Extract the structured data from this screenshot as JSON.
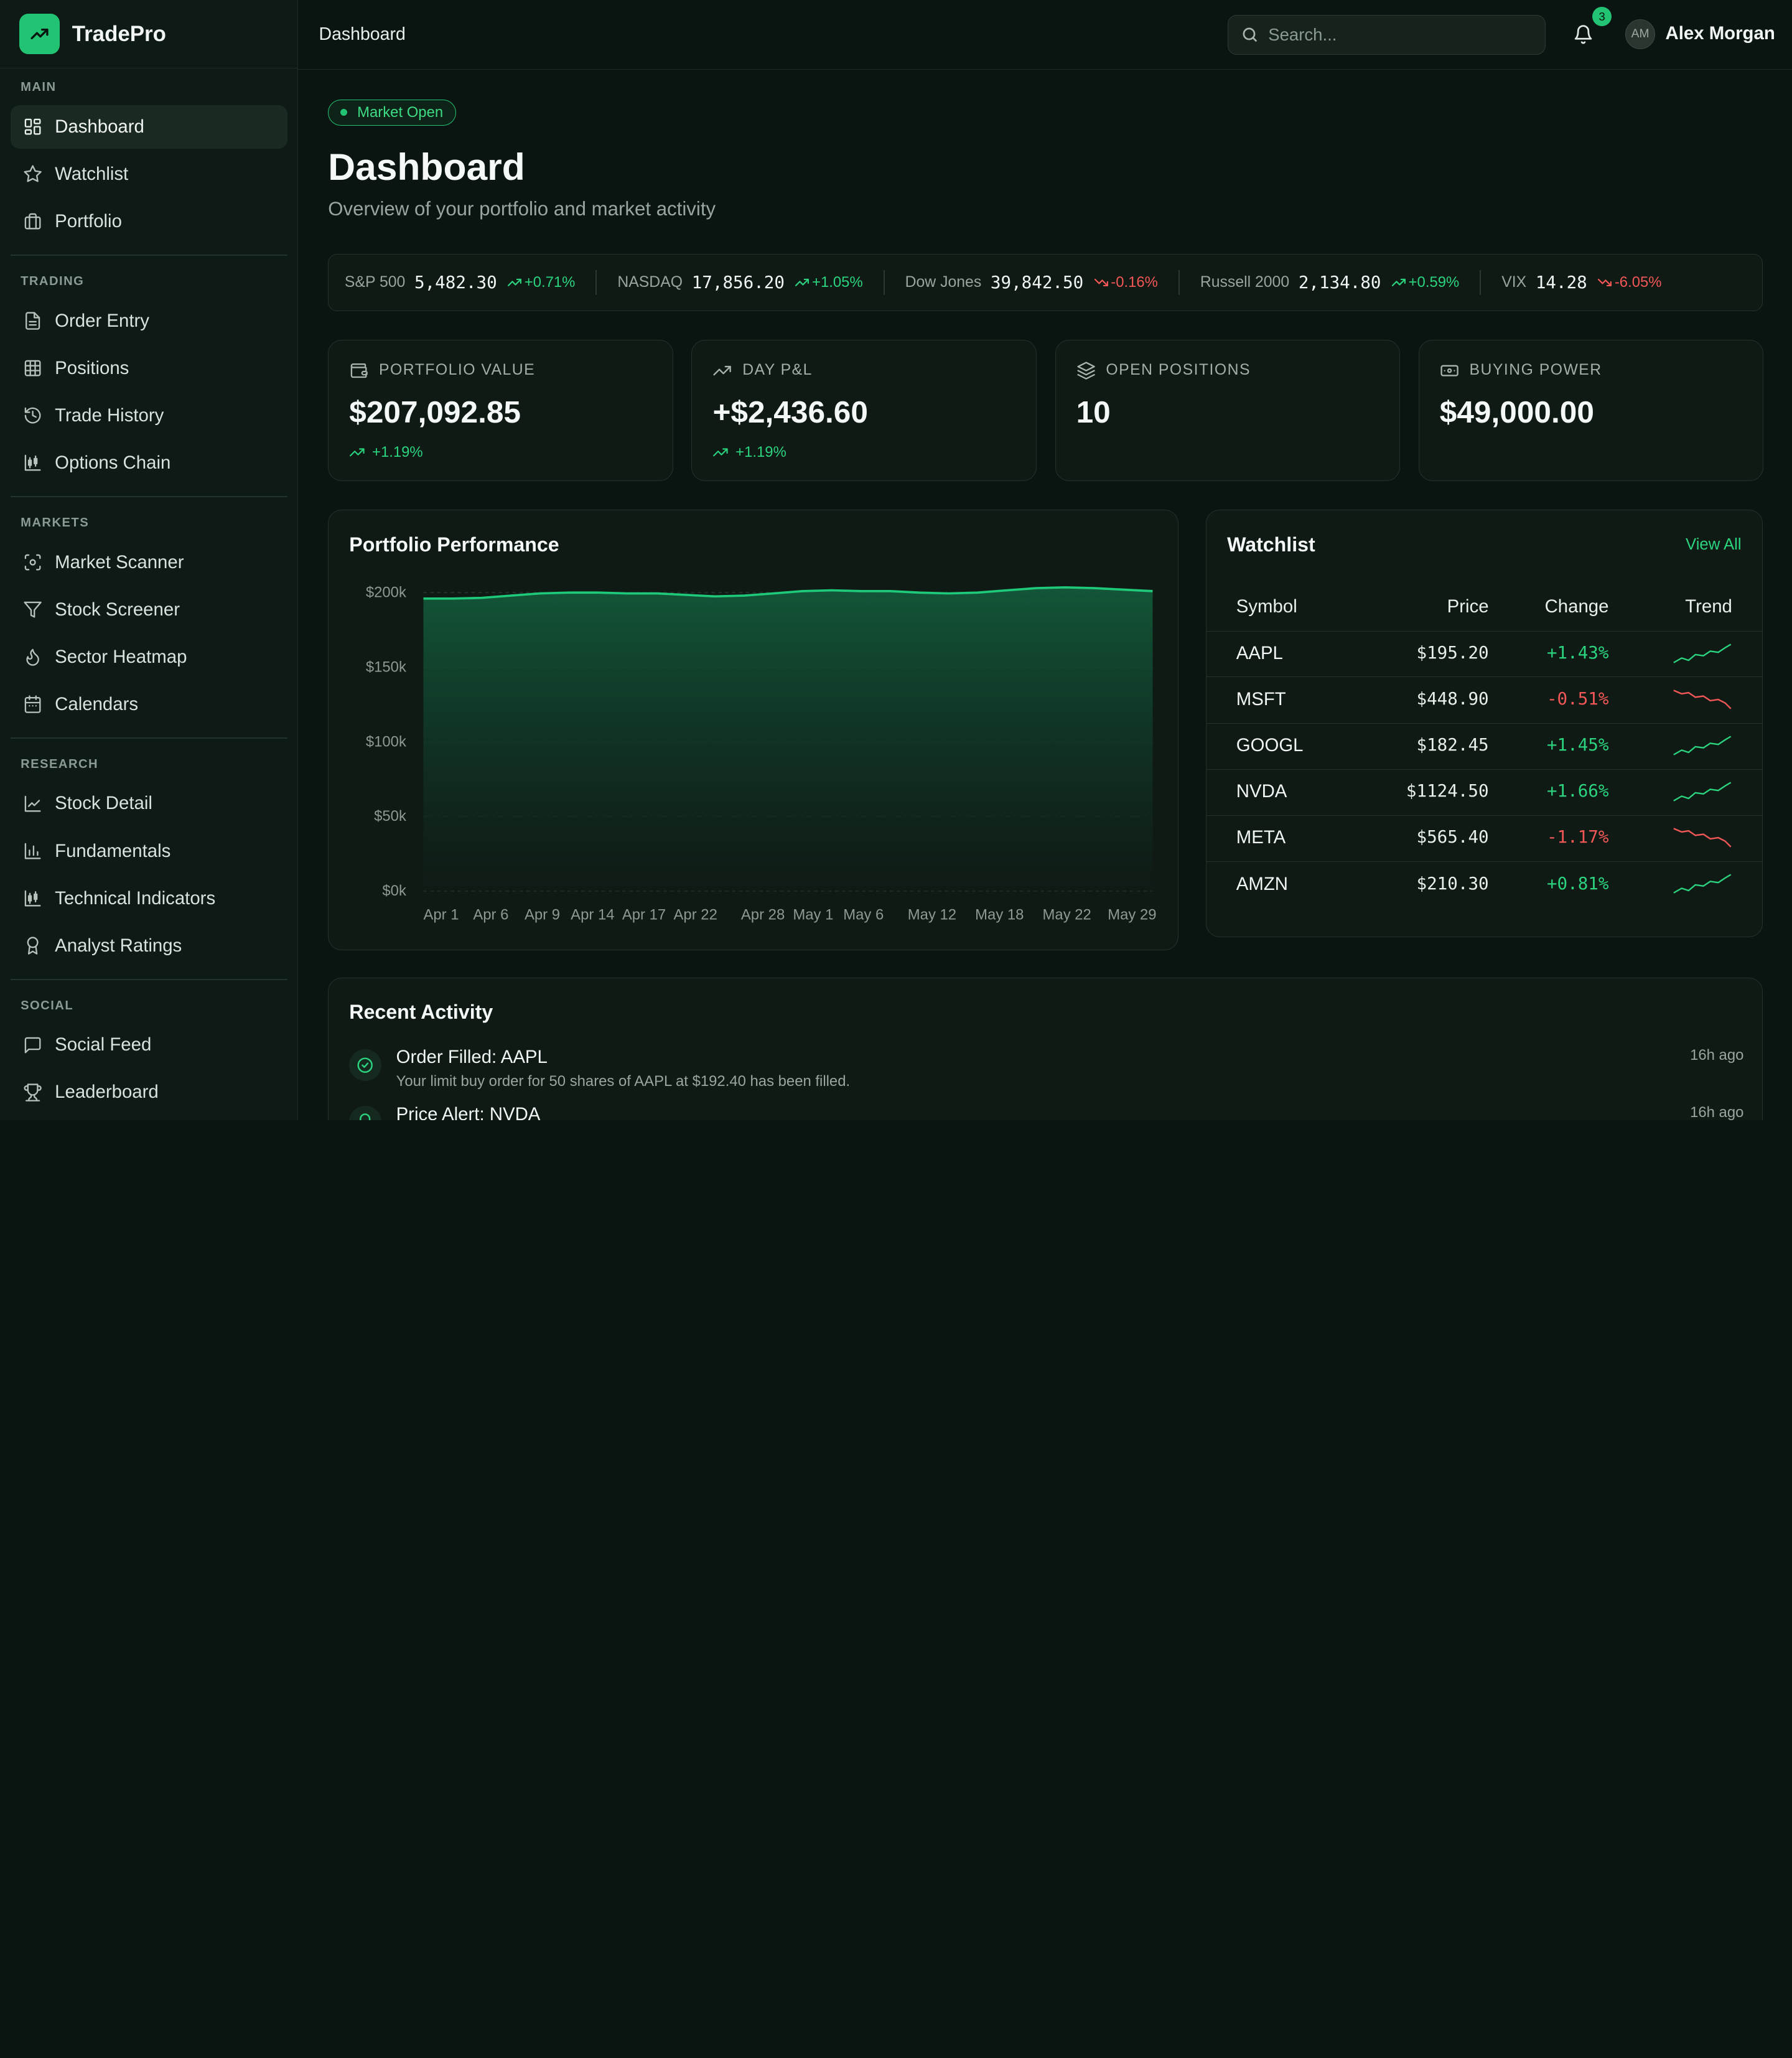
{
  "brand": {
    "name": "TradePro"
  },
  "header": {
    "title": "Dashboard",
    "search_placeholder": "Search...",
    "notification_count": "3",
    "user_initials": "AM",
    "user_name": "Alex Morgan"
  },
  "sidebar": {
    "sections": [
      {
        "title": "MAIN",
        "items": [
          {
            "label": "Dashboard",
            "icon": "dashboard-grid-icon",
            "active": true
          },
          {
            "label": "Watchlist",
            "icon": "star-icon"
          },
          {
            "label": "Portfolio",
            "icon": "briefcase-icon"
          }
        ]
      },
      {
        "title": "TRADING",
        "items": [
          {
            "label": "Order Entry",
            "icon": "document-icon"
          },
          {
            "label": "Positions",
            "icon": "table-grid-icon"
          },
          {
            "label": "Trade History",
            "icon": "history-icon"
          },
          {
            "label": "Options Chain",
            "icon": "candlestick-icon"
          }
        ]
      },
      {
        "title": "MARKETS",
        "items": [
          {
            "label": "Market Scanner",
            "icon": "scan-icon"
          },
          {
            "label": "Stock Screener",
            "icon": "filter-icon"
          },
          {
            "label": "Sector Heatmap",
            "icon": "flame-icon"
          },
          {
            "label": "Calendars",
            "icon": "calendar-icon"
          }
        ]
      },
      {
        "title": "RESEARCH",
        "items": [
          {
            "label": "Stock Detail",
            "icon": "line-chart-icon"
          },
          {
            "label": "Fundamentals",
            "icon": "bar-chart-icon"
          },
          {
            "label": "Technical Indicators",
            "icon": "candlestick-icon"
          },
          {
            "label": "Analyst Ratings",
            "icon": "award-icon"
          }
        ]
      },
      {
        "title": "SOCIAL",
        "items": [
          {
            "label": "Social Feed",
            "icon": "message-icon"
          },
          {
            "label": "Leaderboard",
            "icon": "trophy-icon"
          }
        ]
      }
    ]
  },
  "main": {
    "market_status": "Market Open",
    "title": "Dashboard",
    "subtitle": "Overview of your portfolio and market activity"
  },
  "ticker": [
    {
      "name": "S&P 500",
      "value": "5,482.30",
      "change": "+0.71%",
      "direction": "up"
    },
    {
      "name": "NASDAQ",
      "value": "17,856.20",
      "change": "+1.05%",
      "direction": "up"
    },
    {
      "name": "Dow Jones",
      "value": "39,842.50",
      "change": "-0.16%",
      "direction": "down"
    },
    {
      "name": "Russell 2000",
      "value": "2,134.80",
      "change": "+0.59%",
      "direction": "up"
    },
    {
      "name": "VIX",
      "value": "14.28",
      "change": "-6.05%",
      "direction": "down"
    }
  ],
  "stats": [
    {
      "label": "PORTFOLIO VALUE",
      "value": "$207,092.85",
      "change": "+1.19%",
      "icon": "wallet-icon"
    },
    {
      "label": "DAY P&L",
      "value": "+$2,436.60",
      "change": "+1.19%",
      "icon": "trending-up-icon"
    },
    {
      "label": "OPEN POSITIONS",
      "value": "10",
      "change": "",
      "icon": "layers-icon"
    },
    {
      "label": "BUYING POWER",
      "value": "$49,000.00",
      "change": "",
      "icon": "banknote-icon"
    }
  ],
  "chart_title": "Portfolio Performance",
  "chart_data": {
    "type": "area",
    "title": "Portfolio Performance",
    "x_ticks": [
      "Apr 1",
      "Apr 6",
      "Apr 9",
      "Apr 14",
      "Apr 17",
      "Apr 22",
      "Apr 28",
      "May 1",
      "May 6",
      "May 12",
      "May 18",
      "May 22",
      "May 29"
    ],
    "y_ticks": [
      "$0k",
      "$50k",
      "$100k",
      "$150k",
      "$200k"
    ],
    "ylim": [
      0,
      200000
    ],
    "series": [
      {
        "values": [
          196000,
          196000,
          196500,
          198000,
          199500,
          200000,
          200000,
          199500,
          199500,
          198500,
          197500,
          198000,
          199500,
          201000,
          201500,
          201000,
          201000,
          200000,
          199500,
          200000,
          201500,
          203000,
          203500,
          203000,
          202000,
          201000
        ]
      }
    ],
    "colors": {
      "line": "#1fc97a",
      "fill_top": "#12593a",
      "fill_bottom": "#0f1a15"
    }
  },
  "watchlist": {
    "title": "Watchlist",
    "view_all": "View All",
    "columns": [
      "Symbol",
      "Price",
      "Change",
      "Trend"
    ],
    "rows": [
      {
        "symbol": "AAPL",
        "price": "$195.20",
        "change": "+1.43%",
        "direction": "up"
      },
      {
        "symbol": "MSFT",
        "price": "$448.90",
        "change": "-0.51%",
        "direction": "down"
      },
      {
        "symbol": "GOOGL",
        "price": "$182.45",
        "change": "+1.45%",
        "direction": "up"
      },
      {
        "symbol": "NVDA",
        "price": "$1124.50",
        "change": "+1.66%",
        "direction": "up"
      },
      {
        "symbol": "META",
        "price": "$565.40",
        "change": "-1.17%",
        "direction": "down"
      },
      {
        "symbol": "AMZN",
        "price": "$210.30",
        "change": "+0.81%",
        "direction": "up"
      }
    ]
  },
  "activity": {
    "title": "Recent Activity",
    "items": [
      {
        "title": "Order Filled: AAPL",
        "desc": "Your limit buy order for 50 shares of AAPL at $192.40 has been filled.",
        "time": "16h ago",
        "icon": "check-circle-icon"
      },
      {
        "title": "Price Alert: NVDA",
        "desc": "",
        "time": "16h ago",
        "icon": "bell-icon"
      }
    ]
  },
  "colors": {
    "accent": "#22c474",
    "up": "#2bd37f",
    "down": "#f25757",
    "background": "#0a1410",
    "card": "#0f1a15"
  }
}
